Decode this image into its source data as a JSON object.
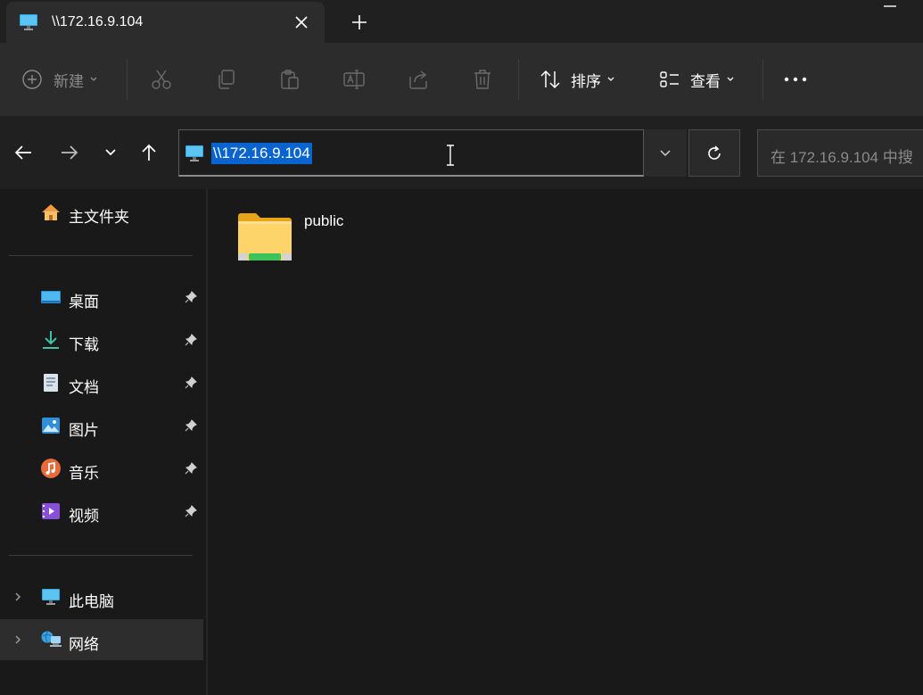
{
  "tab": {
    "title": "\\\\172.16.9.104"
  },
  "toolbar": {
    "new_label": "新建",
    "sort_label": "排序",
    "view_label": "查看"
  },
  "address": {
    "path": "\\\\172.16.9.104",
    "search_placeholder": "在 172.16.9.104 中搜"
  },
  "sidebar": {
    "home": "主文件夹",
    "quick": [
      {
        "label": "桌面",
        "icon": "desktop-icon"
      },
      {
        "label": "下载",
        "icon": "download-icon"
      },
      {
        "label": "文档",
        "icon": "documents-icon"
      },
      {
        "label": "图片",
        "icon": "pictures-icon"
      },
      {
        "label": "音乐",
        "icon": "music-icon"
      },
      {
        "label": "视频",
        "icon": "videos-icon"
      }
    ],
    "this_pc": "此电脑",
    "network": "网络"
  },
  "main": {
    "items": [
      {
        "name": "public",
        "icon": "folder-icon"
      }
    ]
  },
  "colors": {
    "accent": "#0a64d0",
    "background": "#191919",
    "toolbar": "#2c2c2c"
  }
}
